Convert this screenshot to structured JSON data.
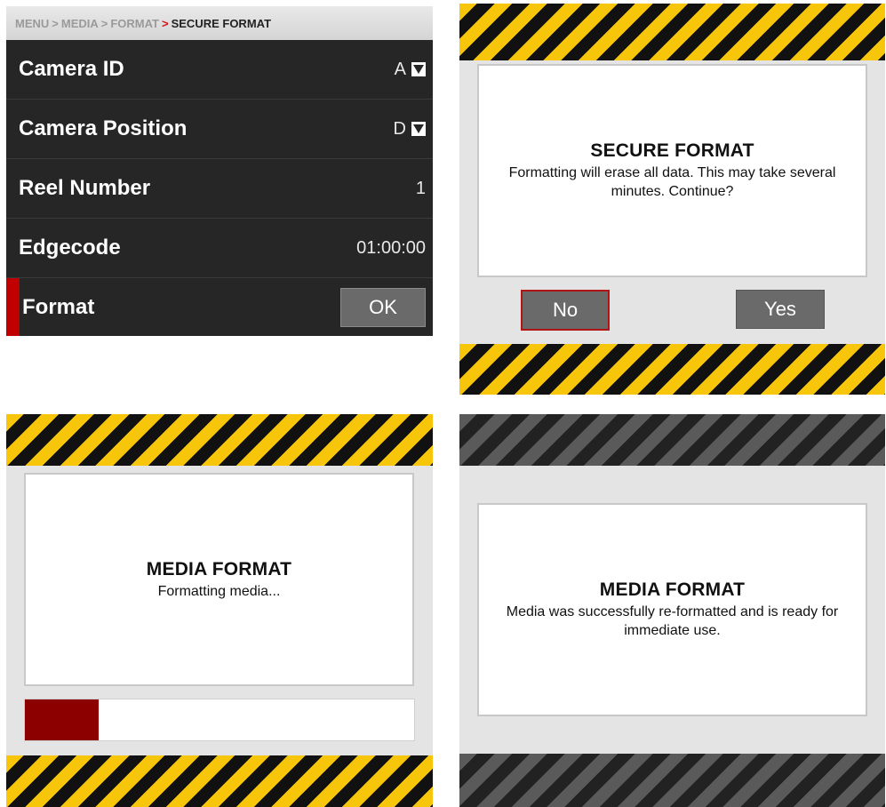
{
  "menu_screen": {
    "breadcrumb": {
      "items": [
        "MENU",
        "MEDIA",
        "FORMAT"
      ],
      "current": "SECURE FORMAT",
      "separator": ">"
    },
    "rows": [
      {
        "label": "Camera ID",
        "value": "A",
        "control": "dropdown"
      },
      {
        "label": "Camera Position",
        "value": "D",
        "control": "dropdown"
      },
      {
        "label": "Reel Number",
        "value": "1",
        "control": "text"
      },
      {
        "label": "Edgecode",
        "value": "01:00:00",
        "control": "text"
      },
      {
        "label": "Format",
        "value": "OK",
        "control": "button",
        "selected": true
      }
    ],
    "colors": {
      "background": "#262626",
      "selection": "#c00000",
      "breadcrumb_current": "#222222",
      "breadcrumb_arrow": "#d21414"
    }
  },
  "confirm_dialog": {
    "title": "SECURE FORMAT",
    "message": "Formatting will erase all data. This may take several minutes. Continue?",
    "no_label": "No",
    "yes_label": "Yes",
    "focused": "No",
    "stripe_colors": [
      "#f7c60a",
      "#111111"
    ]
  },
  "progress_dialog": {
    "title": "MEDIA FORMAT",
    "message": "Formatting media...",
    "progress": 0.19,
    "progress_color": "#8c0000",
    "stripe_colors": [
      "#f7c60a",
      "#111111"
    ]
  },
  "success_dialog": {
    "title": "MEDIA FORMAT",
    "message": "Media was successfully re-formatted and is ready for immediate use.",
    "stripe_colors": [
      "#5a5a5a",
      "#222222"
    ]
  }
}
